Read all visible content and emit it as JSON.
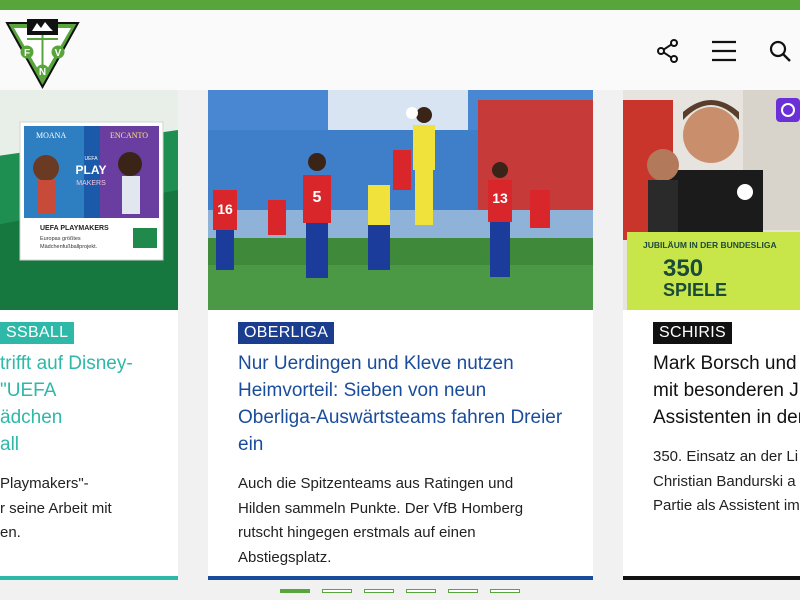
{
  "header": {
    "logo_letters": [
      "F",
      "V",
      "N"
    ],
    "share_icon": "share-icon",
    "menu_icon": "hamburger-menu-icon",
    "search_icon": "search-icon"
  },
  "colors": {
    "brand_green": "#58a53b",
    "teal": "#2db8a8",
    "navy": "#1a3d8f",
    "black": "#111111"
  },
  "cards": [
    {
      "category": "SSBALL",
      "title_lines": [
        "trifft auf Disney-",
        "\"UEFA",
        "ädchen",
        "all"
      ],
      "excerpt_lines": [
        "Playmakers\"-",
        "r seine Arbeit mit",
        "en."
      ],
      "image_text": {
        "moana": "MOANA",
        "encanto": "ENCANTO",
        "uefa": "UEFA",
        "play": "PLAY",
        "makers": "MAKERS",
        "caption": "UEFA PLAYMAKERS",
        "sub1": "Europas größtes",
        "sub2": "Mädchenfußballprojekt."
      }
    },
    {
      "category": "OBERLIGA",
      "title_lines": [
        "Nur Uerdingen und Kleve nutzen",
        "Heimvorteil: Sieben von neun",
        "Oberliga-Auswärtsteams fahren Dreier",
        "ein"
      ],
      "excerpt_lines": [
        "Auch die Spitzenteams aus Ratingen und",
        "Hilden sammeln Punkte. Der VfB Homberg",
        "rutscht hingegen erstmals auf einen",
        "Abstiegsplatz."
      ],
      "image_text": {
        "n16": "16",
        "n5": "5",
        "n13": "13"
      }
    },
    {
      "category": "SCHIRIS",
      "title_lines": [
        "Mark Borsch und",
        "mit besonderen Ju",
        "Assistenten in der"
      ],
      "excerpt_lines": [
        "350. Einsatz an der Li",
        "Christian Bandurski a",
        "Partie als Assistent im"
      ],
      "image_text": {
        "jubi": "JUBILÄUM IN DER BUNDESLIGA",
        "spiele": "350",
        "spiele2": "SPIELE"
      }
    }
  ],
  "carousel": {
    "total": 6,
    "active": 0
  }
}
